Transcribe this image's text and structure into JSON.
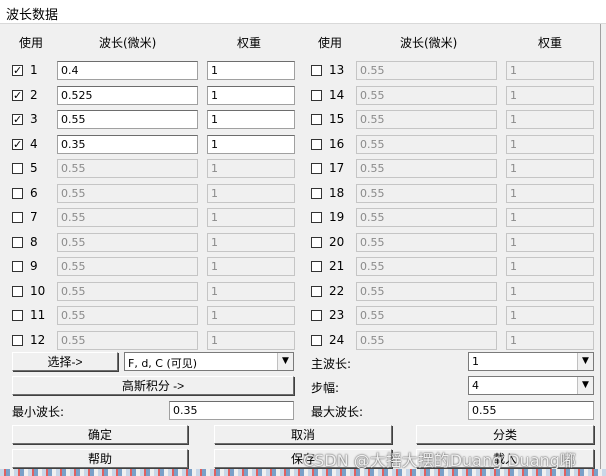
{
  "window": {
    "title": "波长数据"
  },
  "headers": {
    "use": "使用",
    "wavelength": "波长(微米)",
    "weight": "权重",
    "use2": "使用",
    "wavelength2": "波长(微米)",
    "weight2": "权重"
  },
  "left_rows": [
    {
      "num": "1",
      "checked": true,
      "wave": "0.4",
      "weight": "1",
      "enabled": true
    },
    {
      "num": "2",
      "checked": true,
      "wave": "0.525",
      "weight": "1",
      "enabled": true
    },
    {
      "num": "3",
      "checked": true,
      "wave": "0.55",
      "weight": "1",
      "enabled": true
    },
    {
      "num": "4",
      "checked": true,
      "wave": "0.35",
      "weight": "1",
      "enabled": true
    },
    {
      "num": "5",
      "checked": false,
      "wave": "0.55",
      "weight": "1",
      "enabled": false
    },
    {
      "num": "6",
      "checked": false,
      "wave": "0.55",
      "weight": "1",
      "enabled": false
    },
    {
      "num": "7",
      "checked": false,
      "wave": "0.55",
      "weight": "1",
      "enabled": false
    },
    {
      "num": "8",
      "checked": false,
      "wave": "0.55",
      "weight": "1",
      "enabled": false
    },
    {
      "num": "9",
      "checked": false,
      "wave": "0.55",
      "weight": "1",
      "enabled": false
    },
    {
      "num": "10",
      "checked": false,
      "wave": "0.55",
      "weight": "1",
      "enabled": false
    },
    {
      "num": "11",
      "checked": false,
      "wave": "0.55",
      "weight": "1",
      "enabled": false
    },
    {
      "num": "12",
      "checked": false,
      "wave": "0.55",
      "weight": "1",
      "enabled": false
    }
  ],
  "right_rows": [
    {
      "num": "13",
      "checked": false,
      "wave": "0.55",
      "weight": "1",
      "enabled": false
    },
    {
      "num": "14",
      "checked": false,
      "wave": "0.55",
      "weight": "1",
      "enabled": false
    },
    {
      "num": "15",
      "checked": false,
      "wave": "0.55",
      "weight": "1",
      "enabled": false
    },
    {
      "num": "16",
      "checked": false,
      "wave": "0.55",
      "weight": "1",
      "enabled": false
    },
    {
      "num": "17",
      "checked": false,
      "wave": "0.55",
      "weight": "1",
      "enabled": false
    },
    {
      "num": "18",
      "checked": false,
      "wave": "0.55",
      "weight": "1",
      "enabled": false
    },
    {
      "num": "19",
      "checked": false,
      "wave": "0.55",
      "weight": "1",
      "enabled": false
    },
    {
      "num": "20",
      "checked": false,
      "wave": "0.55",
      "weight": "1",
      "enabled": false
    },
    {
      "num": "21",
      "checked": false,
      "wave": "0.55",
      "weight": "1",
      "enabled": false
    },
    {
      "num": "22",
      "checked": false,
      "wave": "0.55",
      "weight": "1",
      "enabled": false
    },
    {
      "num": "23",
      "checked": false,
      "wave": "0.55",
      "weight": "1",
      "enabled": false
    },
    {
      "num": "24",
      "checked": false,
      "wave": "0.55",
      "weight": "1",
      "enabled": false
    }
  ],
  "controls": {
    "select_button": "选择->",
    "preset_combo": "F, d, C (可见)",
    "gauss_button": "高斯积分 ->",
    "min_wave_label": "最小波长:",
    "min_wave_value": "0.35",
    "primary_label": "主波长:",
    "primary_value": "1",
    "step_label": "步幅:",
    "step_value": "4",
    "max_wave_label": "最大波长:",
    "max_wave_value": "0.55"
  },
  "buttons": {
    "ok": "确定",
    "cancel": "取消",
    "sort": "分类",
    "help": "帮助",
    "save": "保存",
    "load": "载入"
  },
  "watermark": "CSDN @大摇大摆的Duang Duang嘟"
}
